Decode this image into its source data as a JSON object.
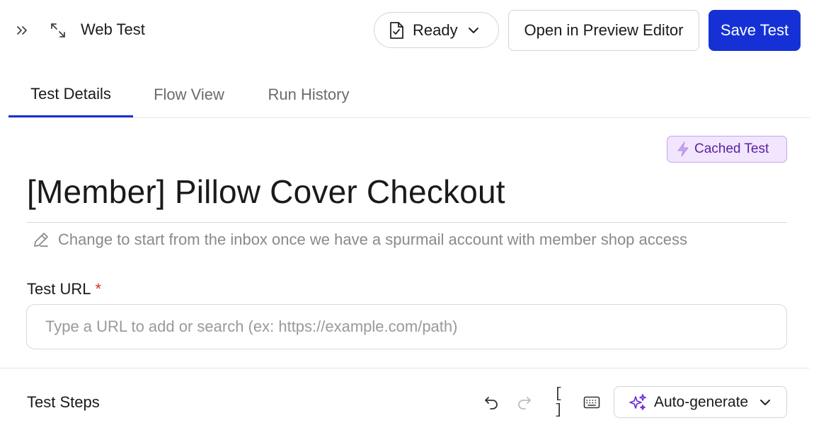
{
  "header": {
    "sidebar_toggle_icon": "double-chevron-right-icon",
    "expand_icon": "expand-arrows-icon",
    "title": "Web Test",
    "status": {
      "label": "Ready",
      "icon": "file-check-icon",
      "chevron": "chevron-down-icon"
    },
    "preview_button": "Open in Preview Editor",
    "save_button": "Save Test",
    "accent_color": "#1531d6"
  },
  "tabs": [
    {
      "label": "Test Details",
      "active": true
    },
    {
      "label": "Flow View",
      "active": false
    },
    {
      "label": "Run History",
      "active": false
    }
  ],
  "test": {
    "badge": {
      "label": "Cached Test",
      "icon": "lightning-icon",
      "color": "#5b21a6",
      "background": "#f1e6fd"
    },
    "title": "[Member] Pillow Cover Checkout",
    "description": "Change to start from the inbox once we have a spurmail account with member shop access",
    "description_icon": "pencil-icon",
    "url_label": "Test URL",
    "url_required_marker": "*",
    "url_value": "",
    "url_placeholder": "Type a URL to add or search (ex: https://example.com/path)"
  },
  "steps": {
    "title": "Test Steps",
    "toolbar_icons": [
      "undo-icon",
      "redo-icon",
      "brackets-icon",
      "keyboard-icon"
    ],
    "brackets_label": "[ ]",
    "autogenerate": {
      "label": "Auto-generate",
      "icon": "sparkles-icon",
      "chevron": "chevron-down-icon",
      "icon_color": "#6d28d9"
    }
  }
}
